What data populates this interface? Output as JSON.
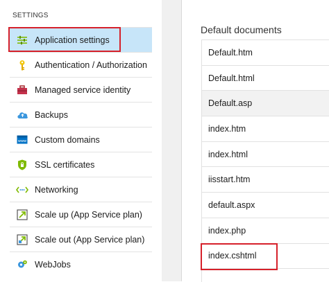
{
  "sidebar": {
    "section_label": "SETTINGS",
    "items": [
      {
        "label": "Application settings",
        "icon": "settings-sliders-icon",
        "active": true
      },
      {
        "label": "Authentication / Authorization",
        "icon": "key-icon"
      },
      {
        "label": "Managed service identity",
        "icon": "toolbox-icon"
      },
      {
        "label": "Backups",
        "icon": "cloud-backup-icon"
      },
      {
        "label": "Custom domains",
        "icon": "www-domain-icon"
      },
      {
        "label": "SSL certificates",
        "icon": "shield-certificate-icon"
      },
      {
        "label": "Networking",
        "icon": "networking-arrows-icon"
      },
      {
        "label": "Scale up (App Service plan)",
        "icon": "scale-up-icon"
      },
      {
        "label": "Scale out (App Service plan)",
        "icon": "scale-out-icon"
      },
      {
        "label": "WebJobs",
        "icon": "webjobs-gear-icon"
      }
    ]
  },
  "main": {
    "title": "Default documents",
    "documents": [
      "Default.htm",
      "Default.html",
      "Default.asp",
      "index.htm",
      "index.html",
      "iisstart.htm",
      "default.aspx",
      "index.php",
      "index.cshtml",
      ""
    ]
  },
  "colors": {
    "active_bg": "#c7e5f9",
    "highlight": "#d6202a",
    "azure_blue": "#0072c6"
  }
}
